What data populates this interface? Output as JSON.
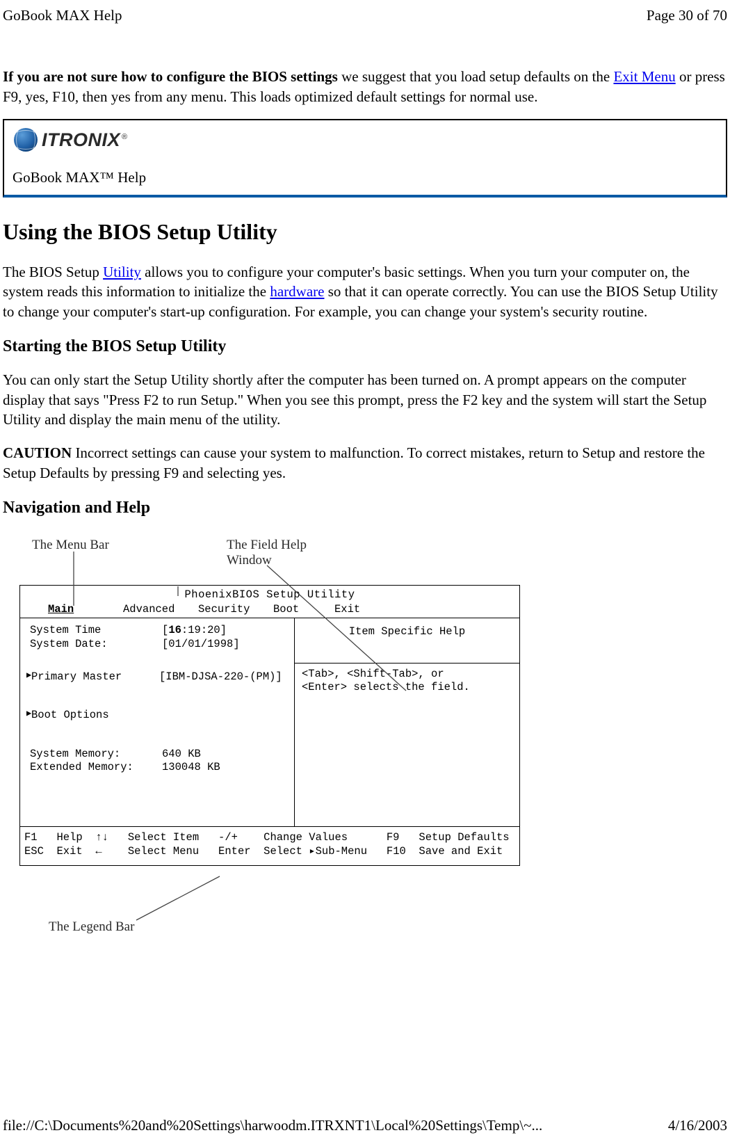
{
  "header": {
    "left": "GoBook MAX Help",
    "right": "Page 30 of 70"
  },
  "intro": {
    "bold_lead": "If you are not sure how to configure the BIOS settings",
    "after_bold": " we suggest that you load setup defaults on the ",
    "link": "Exit Menu",
    "after_link": " or press F9, yes, F10, then yes from any menu. This loads optimized default settings for normal use."
  },
  "logo": {
    "brand": "ITRONIX",
    "reg": "®",
    "product": "GoBook MAX™ Help"
  },
  "h1": "Using the BIOS Setup Utility",
  "para1": {
    "pre": "The BIOS Setup ",
    "link1": "Utility",
    "mid1": " allows you to configure your computer's basic settings. When you turn your computer on, the system reads this information to initialize the ",
    "link2": "hardware",
    "mid2": " so that it can operate correctly. You can use the BIOS Setup Utility to change your computer's start-up configuration. For example, you can change your system's security routine."
  },
  "h2a": "Starting the BIOS Setup Utility",
  "para2": "You can only start the Setup Utility shortly after the computer has been turned on. A prompt appears on the computer display that says \"Press F2 to run Setup.\" When you see this prompt, press the F2 key and the system will start the Setup Utility and display the main menu of the utility.",
  "para3": {
    "bold": "CAUTION",
    "rest": "  Incorrect settings can cause your system to malfunction.  To correct mistakes, return to Setup and restore the Setup Defaults by pressing F9 and selecting yes."
  },
  "h2b": "Navigation and Help",
  "bios": {
    "labels": {
      "menubar": "The Menu Bar",
      "fieldhelp_l1": "The Field Help",
      "fieldhelp_l2": "Window",
      "legend": "The Legend Bar"
    },
    "title": "PhoenixBIOS Setup Utility",
    "tabs": {
      "main": "Main",
      "advanced": "Advanced",
      "security": "Security",
      "boot": "Boot",
      "exit": "Exit"
    },
    "left": {
      "system_time_lbl": "System Time",
      "system_time_val_open": "[",
      "system_time_val_bold": "16",
      "system_time_val_rest": ":19:20]",
      "system_date_lbl": "System Date:",
      "system_date_val": "[01/01/1998]",
      "primary_master_lbl": "Primary Master",
      "primary_master_val": "[IBM-DJSA-220-(PM)]",
      "boot_options_lbl": "Boot Options",
      "sys_mem_lbl": "System Memory:",
      "sys_mem_val": "640 KB",
      "ext_mem_lbl": "Extended Memory:",
      "ext_mem_val": "130048 KB"
    },
    "right": {
      "title": "Item Specific Help",
      "line1": "<Tab>, <Shift-Tab>, or",
      "line2": "<Enter> selects the field."
    },
    "footer": {
      "line1": "F1   Help  ↑↓   Select Item   -/+    Change Values      F9   Setup Defaults",
      "line2": "ESC  Exit  ←    Select Menu   Enter  Select ▸Sub-Menu   F10  Save and Exit"
    }
  },
  "footer": {
    "left": "file://C:\\Documents%20and%20Settings\\harwoodm.ITRXNT1\\Local%20Settings\\Temp\\~...",
    "right": "4/16/2003"
  }
}
